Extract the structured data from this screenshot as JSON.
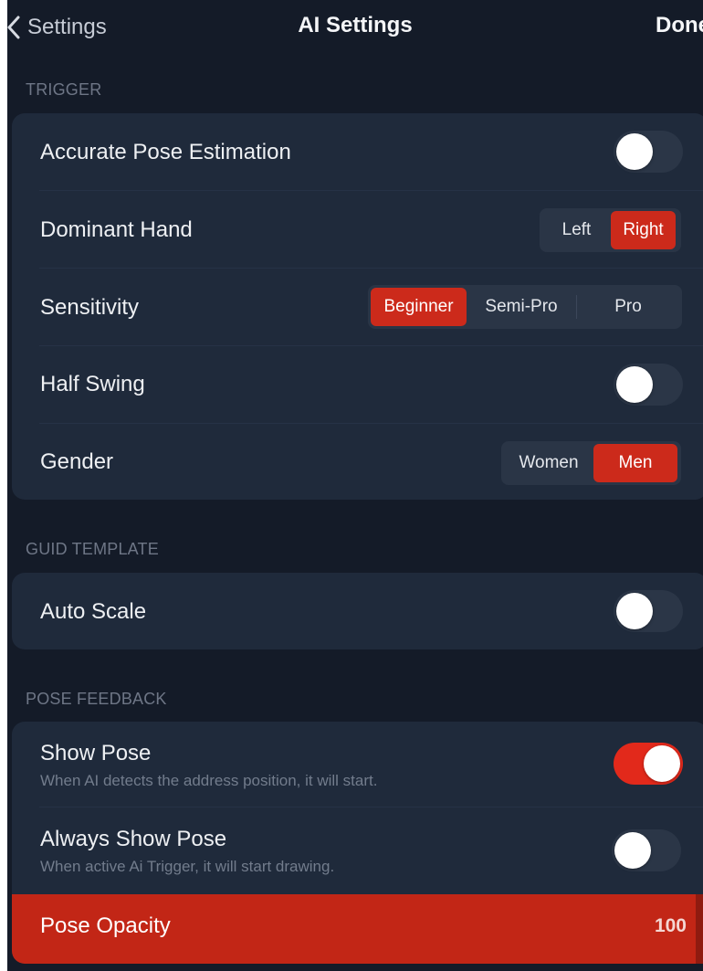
{
  "nav": {
    "back_label": "Settings",
    "title": "AI Settings",
    "done_label": "Done"
  },
  "trigger": {
    "header": "TRIGGER",
    "accurate_pose": {
      "label": "Accurate Pose Estimation",
      "enabled": false
    },
    "dominant_hand": {
      "label": "Dominant Hand",
      "options": [
        "Left",
        "Right"
      ],
      "selected": "Right"
    },
    "sensitivity": {
      "label": "Sensitivity",
      "options": [
        "Beginner",
        "Semi-Pro",
        "Pro"
      ],
      "selected": "Beginner"
    },
    "half_swing": {
      "label": "Half Swing",
      "enabled": false
    },
    "gender": {
      "label": "Gender",
      "options": [
        "Women",
        "Men"
      ],
      "selected": "Men"
    }
  },
  "guide_template": {
    "header": "GUID TEMPLATE",
    "auto_scale": {
      "label": "Auto Scale",
      "enabled": false
    }
  },
  "pose_feedback": {
    "header": "POSE FEEDBACK",
    "show_pose": {
      "label": "Show Pose",
      "subtitle": "When AI detects the address position, it will start.",
      "enabled": true
    },
    "always_show_pose": {
      "label": "Always Show Pose",
      "subtitle": "When active Ai Trigger, it will start drawing.",
      "enabled": false
    },
    "pose_opacity": {
      "label": "Pose Opacity",
      "value": "100"
    }
  },
  "colors": {
    "background": "#141b28",
    "group": "#1f2a3b",
    "accent": "#cc2a1b",
    "toggle_on": "#e2291b"
  }
}
